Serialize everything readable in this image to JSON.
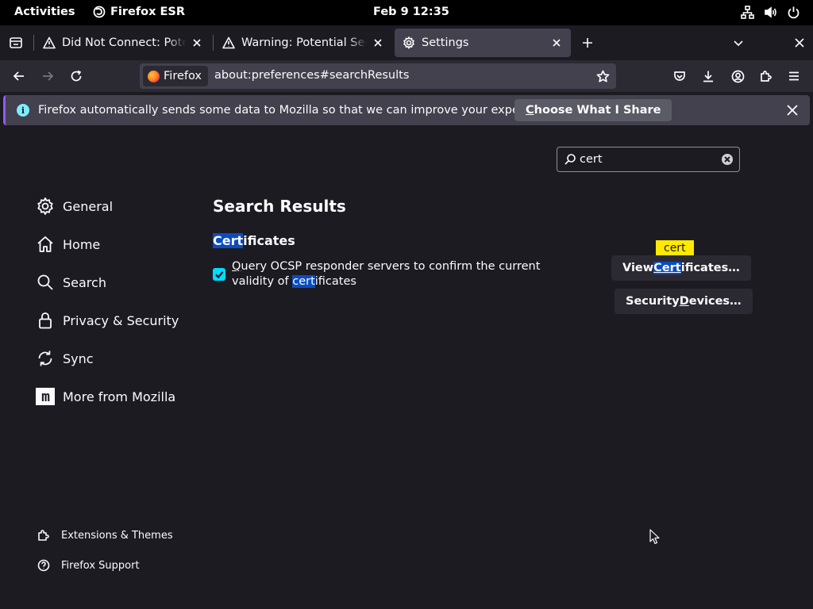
{
  "topbar": {
    "activities": "Activities",
    "app_name": "Firefox ESR",
    "clock": "Feb 9  12:35",
    "icons": [
      "network-icon",
      "volume-icon",
      "power-icon"
    ]
  },
  "tabs": [
    {
      "title": "Did Not Connect: Potential Security Issue",
      "icon": "warning-icon",
      "selected": false
    },
    {
      "title": "Warning: Potential Security Risk Ahead",
      "icon": "warning-icon",
      "selected": false
    },
    {
      "title": "Settings",
      "icon": "gear-icon",
      "selected": true
    }
  ],
  "urlbar": {
    "identity_label": "Firefox",
    "url": "about:preferences#searchResults"
  },
  "notification": {
    "text": "Firefox automatically sends some data to Mozilla so that we can improve your experience.",
    "button_access_key": "C",
    "button_rest": "hoose What I Share"
  },
  "search": {
    "value": "cert"
  },
  "categories": [
    {
      "label": "General",
      "icon": "gear-icon"
    },
    {
      "label": "Home",
      "icon": "home-icon"
    },
    {
      "label": "Search",
      "icon": "search-icon"
    },
    {
      "label": "Privacy & Security",
      "icon": "lock-icon"
    },
    {
      "label": "Sync",
      "icon": "sync-icon"
    },
    {
      "label": "More from Mozilla",
      "icon": "mozilla-m-icon"
    }
  ],
  "footer_links": [
    {
      "label": "Extensions & Themes",
      "icon": "puzzle-icon"
    },
    {
      "label": "Firefox Support",
      "icon": "help-icon"
    }
  ],
  "results": {
    "title": "Search Results",
    "group_hl": "Cert",
    "group_rest": "ificates",
    "checkbox_checked": true,
    "checkbox_key": "Q",
    "checkbox_part1": "uery OCSP responder servers to confirm the current validity of ",
    "checkbox_hl": "cert",
    "checkbox_part2": "ificates",
    "tooltip": "cert",
    "view_btn_pre": "View ",
    "view_btn_hl": "Cert",
    "view_btn_rest": "ificates…",
    "devices_btn_pre": "Security ",
    "devices_btn_key": "D",
    "devices_btn_rest": "evices…"
  },
  "colors": {
    "accent": "#00ddff",
    "highlight": "#0b4dbf",
    "tooltip": "#ffe900",
    "notification_edge": "#9059ff"
  }
}
